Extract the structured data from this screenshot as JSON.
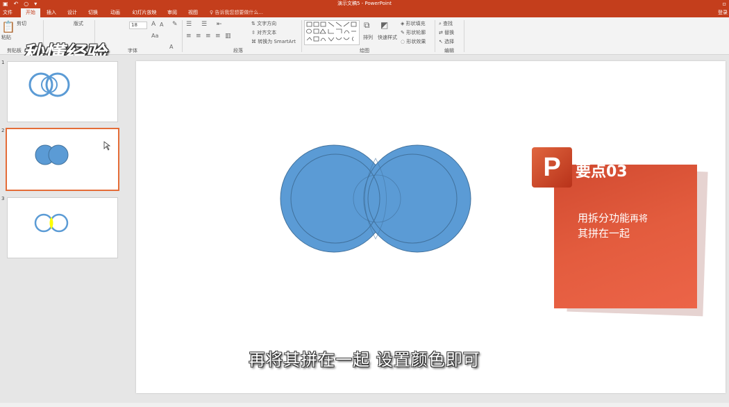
{
  "window": {
    "title": "演示文稿5 - PowerPoint",
    "qat_icons": [
      "save-icon",
      "undo-icon",
      "redo-icon",
      "customize-icon"
    ],
    "restore_glyph": "▫"
  },
  "tabs": [
    {
      "label": "文件"
    },
    {
      "label": "开始"
    },
    {
      "label": "插入"
    },
    {
      "label": "设计"
    },
    {
      "label": "切换"
    },
    {
      "label": "动画"
    },
    {
      "label": "幻灯片放映"
    },
    {
      "label": "审阅"
    },
    {
      "label": "视图"
    }
  ],
  "active_tab": "开始",
  "tell_me": "♀ 告诉我您想要做什么...",
  "sign_in": "登录",
  "ribbon": {
    "groups": {
      "clipboard": "剪贴板",
      "slides": "幻灯片",
      "font": "字体",
      "paragraph": "段落",
      "drawing": "绘图",
      "editing": "编辑"
    },
    "paste_label": "粘贴",
    "cut_label": "剪切",
    "layout_label": "版式",
    "font_size": "18",
    "text_direction": "文字方向",
    "align_text": "对齐文本",
    "convert_smartart": "转换为 SmartArt",
    "arrange": "排列",
    "quick_styles": "快速样式",
    "shape_fill": "形状填充",
    "shape_outline": "形状轮廓",
    "shape_effects": "形状效果",
    "find": "查找",
    "replace": "替换",
    "select": "选择"
  },
  "watermark": "秒懂经验",
  "thumbnails": [
    {
      "number": "1"
    },
    {
      "number": "2"
    },
    {
      "number": "3"
    }
  ],
  "callout": {
    "icon_letter": "P",
    "title": "要点03",
    "line1_big": "用拆分功能",
    "line1_small": "再将",
    "line2": "其拼在一起"
  },
  "caption": "再将其拼在一起 设置颜色即可",
  "colors": {
    "accent": "#c43e1c",
    "circle_fill": "#5b9bd5",
    "circle_stroke": "#41719c",
    "intersect_yellow": "#ffff00"
  }
}
